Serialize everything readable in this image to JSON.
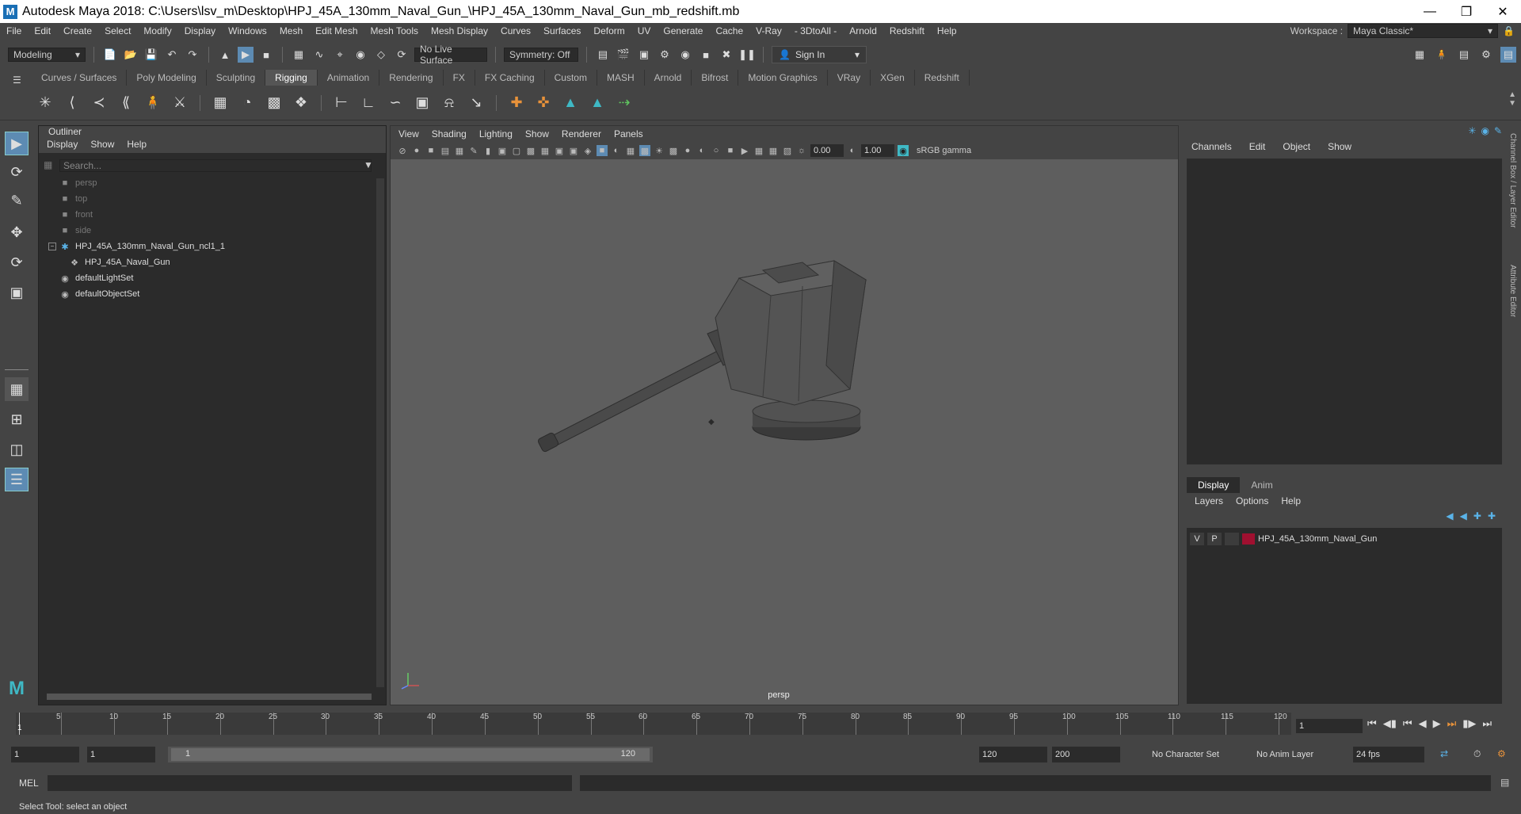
{
  "window": {
    "title": "Autodesk Maya 2018: C:\\Users\\lsv_m\\Desktop\\HPJ_45A_130mm_Naval_Gun_\\HPJ_45A_130mm_Naval_Gun_mb_redshift.mb",
    "logo": "M"
  },
  "menubar": {
    "items": [
      "File",
      "Edit",
      "Create",
      "Select",
      "Modify",
      "Display",
      "Windows",
      "Mesh",
      "Edit Mesh",
      "Mesh Tools",
      "Mesh Display",
      "Curves",
      "Surfaces",
      "Deform",
      "UV",
      "Generate",
      "Cache",
      "V-Ray",
      "- 3DtoAll -",
      "Arnold",
      "Redshift",
      "Help"
    ],
    "workspace_label": "Workspace :",
    "workspace_value": "Maya Classic*"
  },
  "statusline": {
    "mode": "Modeling",
    "live_surface": "No Live Surface",
    "symmetry": "Symmetry: Off",
    "signin": "Sign In"
  },
  "shelf": {
    "tabs": [
      "Curves / Surfaces",
      "Poly Modeling",
      "Sculpting",
      "Rigging",
      "Animation",
      "Rendering",
      "FX",
      "FX Caching",
      "Custom",
      "MASH",
      "Arnold",
      "Bifrost",
      "Motion Graphics",
      "VRay",
      "XGen",
      "Redshift"
    ],
    "active_tab": "Rigging"
  },
  "outliner": {
    "title": "Outliner",
    "menu": [
      "Display",
      "Show",
      "Help"
    ],
    "search_placeholder": "Search...",
    "items": [
      {
        "label": "persp",
        "icon": "camera-icon",
        "dim": true
      },
      {
        "label": "top",
        "icon": "camera-icon",
        "dim": true
      },
      {
        "label": "front",
        "icon": "camera-icon",
        "dim": true
      },
      {
        "label": "side",
        "icon": "camera-icon",
        "dim": true
      },
      {
        "label": "HPJ_45A_130mm_Naval_Gun_ncl1_1",
        "icon": "group-icon",
        "dim": false
      },
      {
        "label": "HPJ_45A_Naval_Gun",
        "icon": "mesh-icon",
        "dim": false
      },
      {
        "label": "defaultLightSet",
        "icon": "set-icon",
        "dim": false
      },
      {
        "label": "defaultObjectSet",
        "icon": "set-icon",
        "dim": false
      }
    ]
  },
  "viewport": {
    "menu": [
      "View",
      "Shading",
      "Lighting",
      "Show",
      "Renderer",
      "Panels"
    ],
    "exposure": "0.00",
    "gamma": "1.00",
    "colorspace": "sRGB gamma",
    "camera_label": "persp"
  },
  "channelbox": {
    "menu": [
      "Channels",
      "Edit",
      "Object",
      "Show"
    ],
    "side_tabs": [
      "Channel Box / Layer Editor",
      "Attribute Editor"
    ]
  },
  "layers": {
    "tabs": [
      "Display",
      "Anim"
    ],
    "active_tab": "Display",
    "menu": [
      "Layers",
      "Options",
      "Help"
    ],
    "rows": [
      {
        "v": "V",
        "p": "P",
        "name": "HPJ_45A_130mm_Naval_Gun",
        "color": "#a01030"
      }
    ]
  },
  "timeslider": {
    "ticks": [
      "5",
      "10",
      "15",
      "20",
      "25",
      "30",
      "35",
      "40",
      "45",
      "50",
      "55",
      "60",
      "65",
      "70",
      "75",
      "80",
      "85",
      "90",
      "95",
      "100",
      "105",
      "110",
      "115",
      "120"
    ],
    "current_frame_marker": "1",
    "current_frame": "1"
  },
  "rangeslider": {
    "start": "1",
    "anim_start": "1",
    "range_start": "1",
    "range_end": "120",
    "anim_end": "120",
    "end": "200",
    "character_set": "No Character Set",
    "anim_layer": "No Anim Layer",
    "fps": "24 fps"
  },
  "mel": {
    "label": "MEL"
  },
  "helpline": {
    "text": "Select Tool: select an object"
  }
}
